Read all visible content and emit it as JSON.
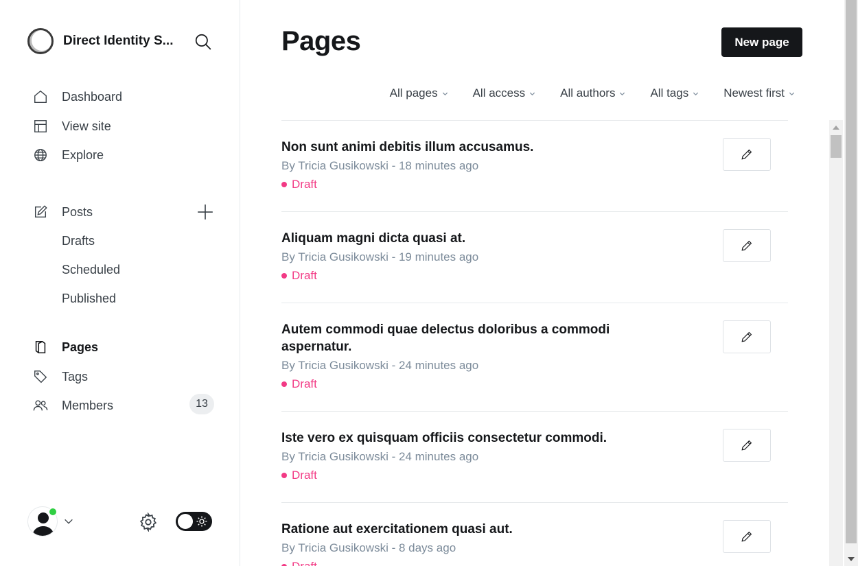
{
  "sidebar": {
    "brand_name": "Direct Identity S...",
    "nav": [
      {
        "label": "Dashboard",
        "icon": "home-icon"
      },
      {
        "label": "View site",
        "icon": "layout-icon"
      },
      {
        "label": "Explore",
        "icon": "globe-icon"
      }
    ],
    "posts": {
      "label": "Posts",
      "icon": "edit-icon",
      "sub": [
        "Drafts",
        "Scheduled",
        "Published"
      ]
    },
    "secondary": [
      {
        "label": "Pages",
        "icon": "book-icon",
        "active": true
      },
      {
        "label": "Tags",
        "icon": "tag-icon"
      },
      {
        "label": "Members",
        "icon": "users-icon",
        "badge": "13"
      }
    ],
    "online_color": "#30cf43"
  },
  "main": {
    "title": "Pages",
    "new_button": "New page",
    "filters": [
      "All pages",
      "All access",
      "All authors",
      "All tags",
      "Newest first"
    ],
    "pages": [
      {
        "title": "Non sunt animi debitis illum accusamus.",
        "meta": "By Tricia Gusikowski - 18 minutes ago",
        "status": "Draft"
      },
      {
        "title": "Aliquam magni dicta quasi at.",
        "meta": "By Tricia Gusikowski - 19 minutes ago",
        "status": "Draft"
      },
      {
        "title": "Autem commodi quae delectus doloribus a commodi aspernatur.",
        "meta": "By Tricia Gusikowski - 24 minutes ago",
        "status": "Draft"
      },
      {
        "title": "Iste vero ex quisquam officiis consectetur commodi.",
        "meta": "By Tricia Gusikowski - 24 minutes ago",
        "status": "Draft"
      },
      {
        "title": "Ratione aut exercitationem quasi aut.",
        "meta": "By Tricia Gusikowski - 8 days ago",
        "status": "Draft"
      }
    ],
    "status_color": "#f23a85"
  }
}
